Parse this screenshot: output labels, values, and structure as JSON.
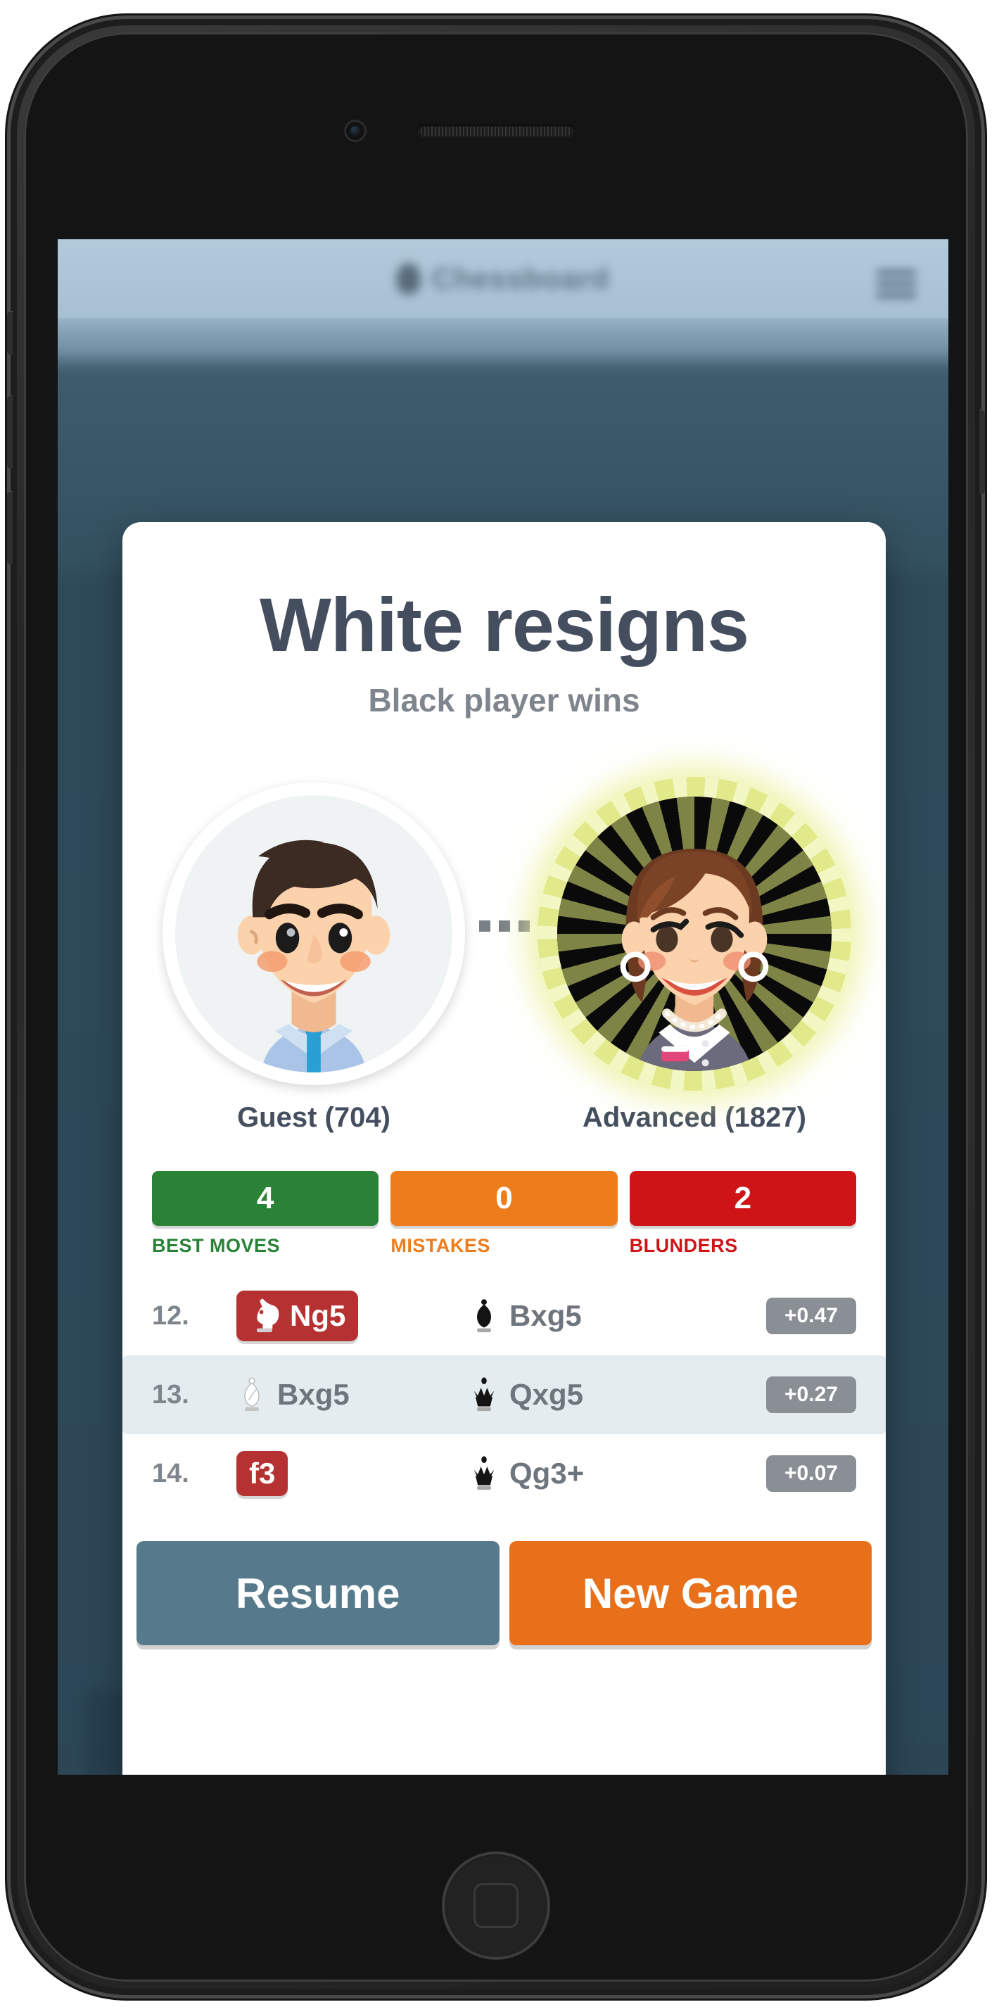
{
  "app": {
    "header_title": "Chessboard",
    "menu_icon": "hamburger-menu-icon",
    "logo_icon": "chess-pawn-icon"
  },
  "result": {
    "title": "White resigns",
    "subtitle": "Black player wins"
  },
  "players": {
    "white": {
      "name": "Guest (704)",
      "avatar_icon": "male-avatar-icon",
      "winner": false
    },
    "separator": "...",
    "black": {
      "name": "Advanced (1827)",
      "avatar_icon": "female-avatar-icon",
      "winner": true
    }
  },
  "stats": [
    {
      "value": "4",
      "label": "BEST MOVES",
      "color": "#298236"
    },
    {
      "value": "0",
      "label": "MISTAKES",
      "color": "#ed7d1c"
    },
    {
      "value": "2",
      "label": "BLUNDERS",
      "color": "#cf1418"
    }
  ],
  "moves": [
    {
      "number": "12.",
      "white": {
        "san": "Ng5",
        "piece": "white-knight-icon",
        "quality": "blunder"
      },
      "black": {
        "san": "Bxg5",
        "piece": "black-bishop-icon",
        "quality": "normal"
      },
      "eval": "+0.47",
      "highlighted": false
    },
    {
      "number": "13.",
      "white": {
        "san": "Bxg5",
        "piece": "white-bishop-icon",
        "quality": "normal"
      },
      "black": {
        "san": "Qxg5",
        "piece": "black-queen-icon",
        "quality": "normal"
      },
      "eval": "+0.27",
      "highlighted": true
    },
    {
      "number": "14.",
      "white": {
        "san": "f3",
        "piece": "none",
        "quality": "blunder"
      },
      "black": {
        "san": "Qg3+",
        "piece": "black-queen-icon",
        "quality": "normal"
      },
      "eval": "+0.07",
      "highlighted": false
    }
  ],
  "actions": {
    "resume_label": "Resume",
    "new_game_label": "New Game"
  },
  "colors": {
    "title_text": "#444e5e",
    "subtitle_text": "#7f858d",
    "resume_button": "#567a8c",
    "new_game_button": "#e8701b",
    "blunder_badge": "#b63232",
    "eval_badge": "#8a8f96",
    "row_highlight": "#e4ecf0",
    "winner_ring": "#e9ee96"
  }
}
